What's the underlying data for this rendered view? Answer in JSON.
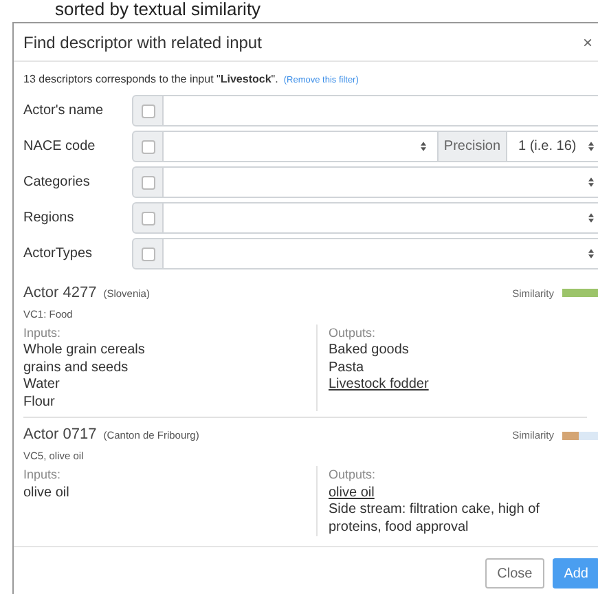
{
  "page_heading": "sorted by textual similarity",
  "dialog": {
    "title": "Find descriptor with related input",
    "close": "×",
    "filter_note": {
      "text": "13 descriptors corresponds to the input \"**Livestock**\".",
      "link": "(Remove this filter)"
    },
    "fields": [
      {
        "label": "Actor's name",
        "kind": "text",
        "checked": false
      },
      {
        "label": "NACE code",
        "kind": "precision",
        "checked": false,
        "addon": "Precision",
        "value": "1 (i.e. 16)"
      },
      {
        "label": "Categories",
        "kind": "select",
        "checked": false
      },
      {
        "label": "Regions",
        "kind": "select",
        "checked": false
      },
      {
        "label": "ActorTypes",
        "kind": "select",
        "checked": false
      }
    ],
    "results": [
      {
        "name": "Actor 4277",
        "region": "(Slovenia)",
        "subtitle": "VC1: Food",
        "similarity_label": "Similarity",
        "level": 0.9,
        "color": "#9cc46a",
        "inputs_label": "Inputs:",
        "inputs": [
          {
            "text": "Whole grain cereals",
            "matched": false
          },
          {
            "text": "grains and seeds",
            "matched": false
          },
          {
            "text": "Water",
            "matched": false
          },
          {
            "text": "Flour",
            "matched": false
          }
        ],
        "outputs_label": "Outputs:",
        "outputs": [
          {
            "text": "Baked goods",
            "matched": false
          },
          {
            "text": "Pasta",
            "matched": false
          },
          {
            "text": "Livestock fodder",
            "matched": true
          }
        ]
      },
      {
        "name": "Actor 0717",
        "region": "(Canton de Fribourg)",
        "subtitle": "VC5, olive oil",
        "similarity_label": "Similarity",
        "level": 0.4,
        "color": "#d4a574",
        "inputs_label": "Inputs:",
        "inputs": [
          {
            "text": "olive oil",
            "matched": false
          }
        ],
        "outputs_label": "Outputs:",
        "outputs": [
          {
            "text": "olive oil",
            "matched": true
          },
          {
            "text": "Side stream: filtration cake, high of proteins, food approval",
            "matched": false
          }
        ]
      }
    ],
    "buttons": [
      {
        "label": "Close",
        "kind": "secondary"
      },
      {
        "label": "Add",
        "kind": "primary"
      }
    ]
  }
}
